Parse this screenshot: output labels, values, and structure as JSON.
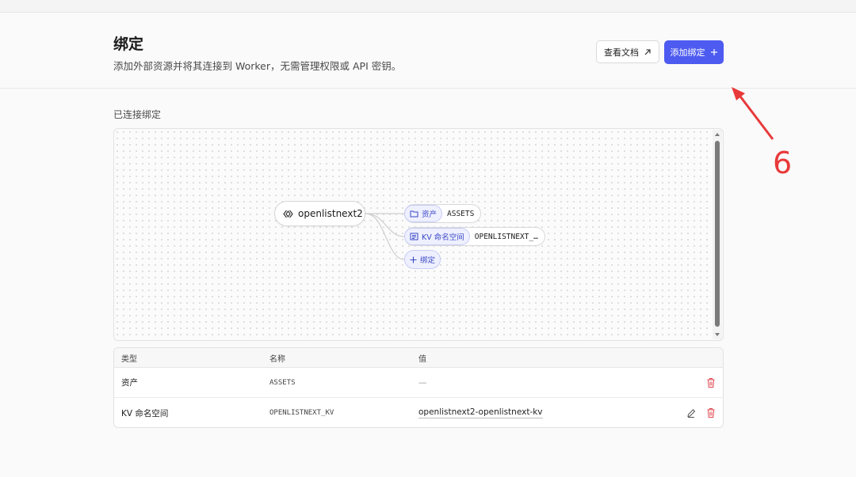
{
  "header": {
    "title": "绑定",
    "subtitle": "添加外部资源并将其连接到 Worker，无需管理权限或 API 密钥。",
    "docs_button": "查看文档",
    "add_button": "添加绑定"
  },
  "section": {
    "label": "已连接绑定"
  },
  "diagram": {
    "worker_name": "openlistnext2",
    "bindings": [
      {
        "type": "资产",
        "name": "ASSETS"
      },
      {
        "type": "KV 命名空间",
        "name": "OPENLISTNEXT_…"
      }
    ],
    "add_binding": "绑定"
  },
  "table": {
    "columns": [
      "类型",
      "名称",
      "值"
    ],
    "rows": [
      {
        "type": "资产",
        "name": "ASSETS",
        "value": "—"
      },
      {
        "type": "KV 命名空间",
        "name": "OPENLISTNEXT_KV",
        "value": "openlistnext2-openlistnext-kv"
      }
    ]
  },
  "annotation": {
    "number": "6",
    "color": "#e83a3a"
  },
  "colors": {
    "accent": "#4d5bf0",
    "danger": "#e0464f"
  }
}
